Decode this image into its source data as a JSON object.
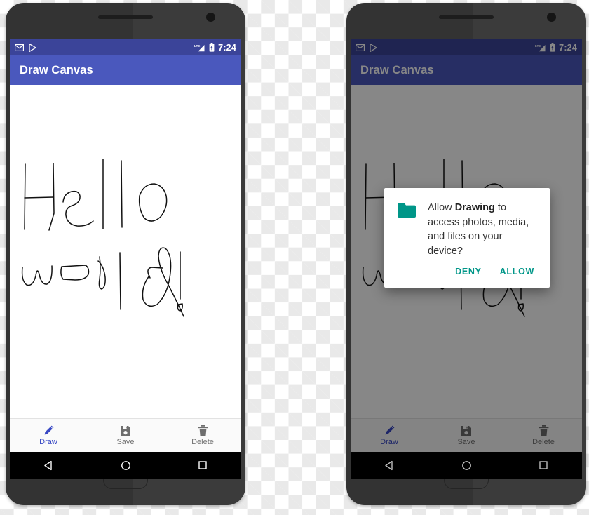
{
  "app": {
    "toolbar_title": "Draw Canvas",
    "accent_blue": "#4a58bd",
    "statusbar_blue": "#3b4499",
    "accent_teal": "#009688"
  },
  "statusbar": {
    "time": "7:24",
    "icons": {
      "gmail": "gmail-icon",
      "play_store": "play-store-icon",
      "signal": "lte-signal-icon",
      "signal_label": "LTE",
      "battery": "battery-icon"
    }
  },
  "canvas": {
    "drawing_line_1": "Hello",
    "drawing_line_2": "world!",
    "stroke_color": "#111111"
  },
  "bottom_nav": {
    "items": [
      {
        "label": "Draw",
        "icon": "pencil-icon",
        "active": true
      },
      {
        "label": "Save",
        "icon": "floppy-disk-icon",
        "active": false
      },
      {
        "label": "Delete",
        "icon": "trash-icon",
        "active": false
      }
    ]
  },
  "system_nav": {
    "back": "back-triangle-icon",
    "home": "home-circle-icon",
    "recents": "recents-square-icon"
  },
  "dialog": {
    "icon": "folder-icon",
    "text_before": "Allow ",
    "app_name": "Drawing",
    "text_after": " to access photos, media, and files on your device?",
    "deny_label": "DENY",
    "allow_label": "ALLOW"
  }
}
